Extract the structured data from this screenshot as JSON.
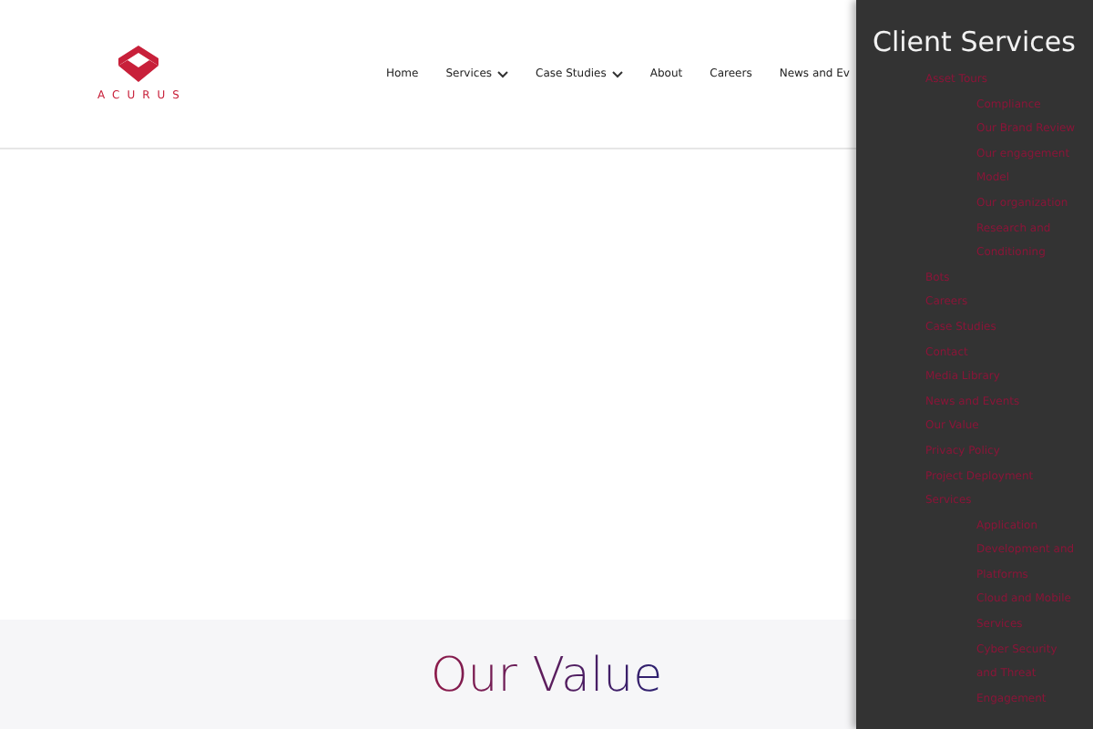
{
  "header": {
    "logo_text": "ACURUS",
    "nav": [
      {
        "label": "Home",
        "has_menu": false
      },
      {
        "label": "Services",
        "has_menu": true
      },
      {
        "label": "Case Studies",
        "has_menu": true
      },
      {
        "label": "About",
        "has_menu": false
      },
      {
        "label": "Careers",
        "has_menu": false
      },
      {
        "label": "News and Ev",
        "has_menu": false
      }
    ]
  },
  "section": {
    "title": "Our Value"
  },
  "sidebar": {
    "title": "Client Services",
    "items": [
      {
        "label": "Asset Tours",
        "children": [
          {
            "label": "Compliance"
          },
          {
            "label": "Our Brand Review"
          },
          {
            "label": "Our engagement"
          },
          {
            "label": "Model"
          },
          {
            "label": "Our organization"
          },
          {
            "label": "Research and"
          },
          {
            "label": "Conditioning"
          }
        ]
      },
      {
        "label": "Bots"
      },
      {
        "label": "Careers"
      },
      {
        "label": "Case Studies"
      },
      {
        "label": "Contact"
      },
      {
        "label": "Media Library"
      },
      {
        "label": "News and Events"
      },
      {
        "label": "Our Value"
      },
      {
        "label": "Privacy Policy"
      },
      {
        "label": "Project Deployment"
      },
      {
        "label": "Services",
        "children": [
          {
            "label": "Application"
          },
          {
            "label": "Development and"
          },
          {
            "label": "Platforms"
          },
          {
            "label": "Cloud and Mobile"
          },
          {
            "label": "Services"
          },
          {
            "label": "Cyber Security"
          },
          {
            "label": "and Threat"
          },
          {
            "label": "Engagement"
          }
        ]
      }
    ]
  }
}
